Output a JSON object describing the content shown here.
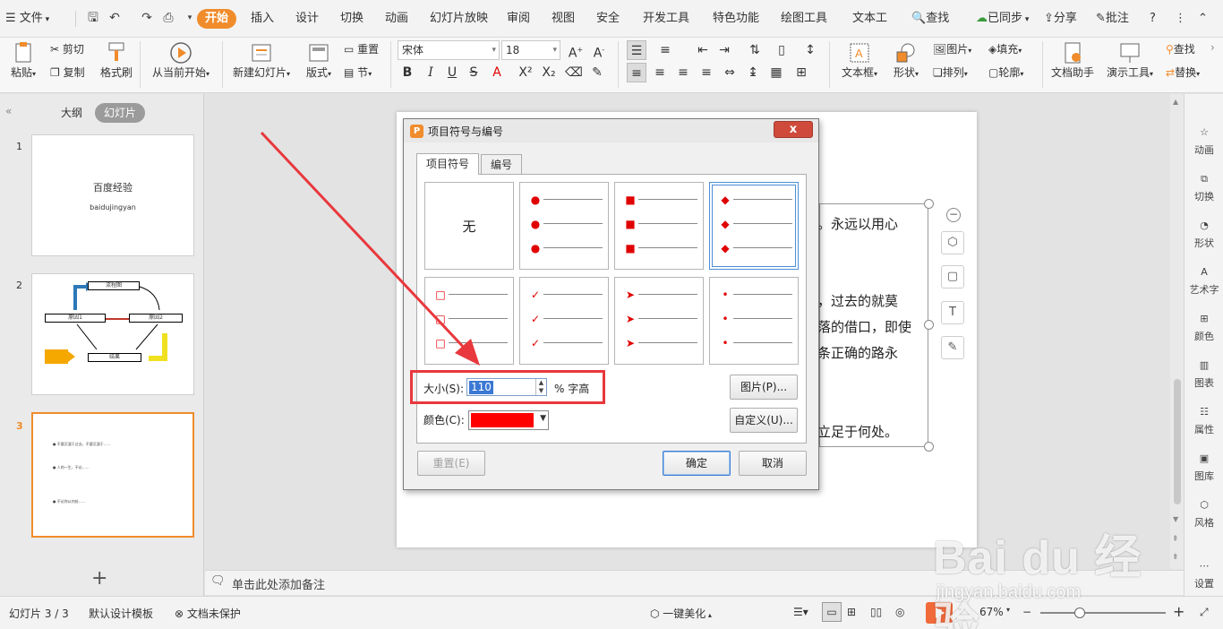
{
  "menubar": {
    "file": "文件",
    "tabs": [
      "开始",
      "插入",
      "设计",
      "切换",
      "动画",
      "幻灯片放映",
      "审阅",
      "视图",
      "安全",
      "开发工具",
      "特色功能",
      "绘图工具",
      "文本工"
    ],
    "search": "查找",
    "sync": "已同步",
    "share": "分享",
    "comment": "批注",
    "help": "?"
  },
  "ribbon": {
    "paste": "粘贴",
    "cut": "剪切",
    "copy": "复制",
    "format_painter": "格式刷",
    "from_current": "从当前开始",
    "new_slide": "新建幻灯片",
    "layout": "版式",
    "reset": "重置",
    "section": "节",
    "font_name": "宋体",
    "font_size": "18",
    "textbox": "文本框",
    "shape": "形状",
    "picture": "图片",
    "fill": "填充",
    "arrange": "排列",
    "outline": "轮廓",
    "doc_assistant": "文档助手",
    "presentation_tools": "演示工具",
    "find": "查找",
    "replace": "替换"
  },
  "leftpanel": {
    "outline_tab": "大纲",
    "slides_tab": "幻灯片",
    "slides": [
      {
        "num": "1",
        "title": "百度经验",
        "subtitle": "baidujingyan"
      },
      {
        "num": "2",
        "nodes": [
          "流程图",
          "原因1",
          "原因2",
          "结果"
        ]
      },
      {
        "num": "3",
        "lines": [
          "● 不要沉湎于过去，不要沉湎于……",
          "● 人的一生，不论……",
          "● 不论你从何处……"
        ]
      }
    ],
    "add_label": "+"
  },
  "slide": {
    "lines": [
      "。永远以用心",
      "，过去的就莫",
      "落的借口，即使",
      "条正确的路永",
      "立足于何处。"
    ]
  },
  "notes": {
    "placeholder": "单击此处添加备注"
  },
  "rightbar": {
    "items": [
      "动画",
      "切换",
      "形状",
      "艺术字",
      "颜色",
      "图表",
      "属性",
      "图库",
      "风格",
      "设置"
    ]
  },
  "statusbar": {
    "slide_info": "幻灯片 3 / 3",
    "template": "默认设计模板",
    "protection": "文档未保护",
    "beautify": "一键美化",
    "zoom": "67%"
  },
  "dialog": {
    "title": "项目符号与编号",
    "close": "x",
    "tab_bullets": "项目符号",
    "tab_numbering": "编号",
    "none_label": "无",
    "bullet_styles": [
      "无",
      "●",
      "■",
      "◆",
      "□",
      "✓",
      "➤",
      "•"
    ],
    "selected_index": 3,
    "size_label": "大小(S):",
    "size_value": "110",
    "size_unit": "% 字高",
    "color_label": "颜色(C):",
    "color_value": "#ff0000",
    "picture_button": "图片(P)...",
    "custom_button": "自定义(U)...",
    "reset_button": "重置(E)",
    "ok_button": "确定",
    "cancel_button": "取消"
  },
  "watermark": {
    "main": "Bai du 经验",
    "sub": "jingyan.baidu.com"
  }
}
